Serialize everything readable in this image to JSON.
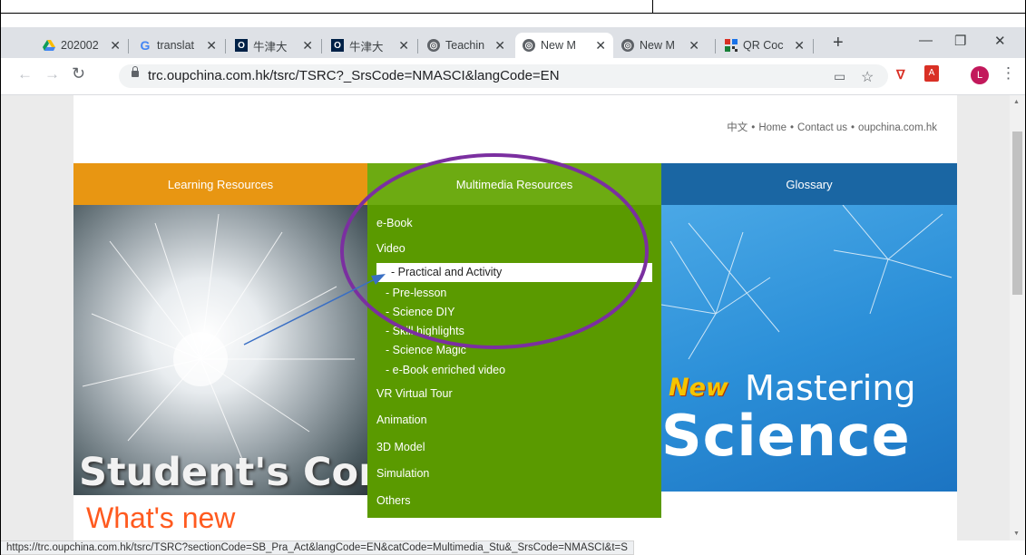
{
  "tabs": [
    {
      "title": "202002",
      "icon": "google-drive-icon"
    },
    {
      "title": "translat",
      "icon": "google-icon"
    },
    {
      "title": "牛津大",
      "icon": "oxford-icon"
    },
    {
      "title": "牛津大",
      "icon": "oxford-icon"
    },
    {
      "title": "Teachin",
      "icon": "globe-icon"
    },
    {
      "title": "New M",
      "icon": "globe-icon",
      "active": true
    },
    {
      "title": "New M",
      "icon": "globe-icon"
    },
    {
      "title": "QR Coc",
      "icon": "qr-code-icon"
    }
  ],
  "browser": {
    "url": "trc.oupchina.com.hk/tsrc/TSRC?_SrsCode=NMASCI&langCode=EN",
    "avatar_letter": "L",
    "status_url": "https://trc.oupchina.com.hk/tsrc/TSRC?sectionCode=SB_Pra_Act&langCode=EN&catCode=Multimedia_Stu&_SrsCode=NMASCI&t=S"
  },
  "page": {
    "top_links": [
      "中文",
      "Home",
      "Contact us",
      "oupchina.com.hk"
    ],
    "nav": {
      "learning": "Learning Resources",
      "multimedia": "Multimedia Resources",
      "glossary": "Glossary"
    },
    "banner_left_text": "Student's Corn",
    "banner_right": {
      "badge": "New",
      "line1": "Mastering",
      "line2": "Science"
    },
    "whats_new": "What's new"
  },
  "dropdown": {
    "ebook": "e-Book",
    "video": "Video",
    "video_items": [
      "- Practical and Activity",
      "- Pre-lesson",
      "- Science DIY",
      "- Skill highlights",
      "- Science Magic",
      "- e-Book enriched video"
    ],
    "vr": "VR Virtual Tour",
    "animation": "Animation",
    "model": "3D Model",
    "simulation": "Simulation",
    "others": "Others"
  },
  "colors": {
    "learning_tab": "#e89612",
    "multimedia_tab": "#6dab12",
    "glossary_tab": "#1a66a3",
    "dropdown_bg": "#5a9a00",
    "annotation_ellipse": "#7b2fa0",
    "annotation_arrow": "#3a6fc4"
  }
}
